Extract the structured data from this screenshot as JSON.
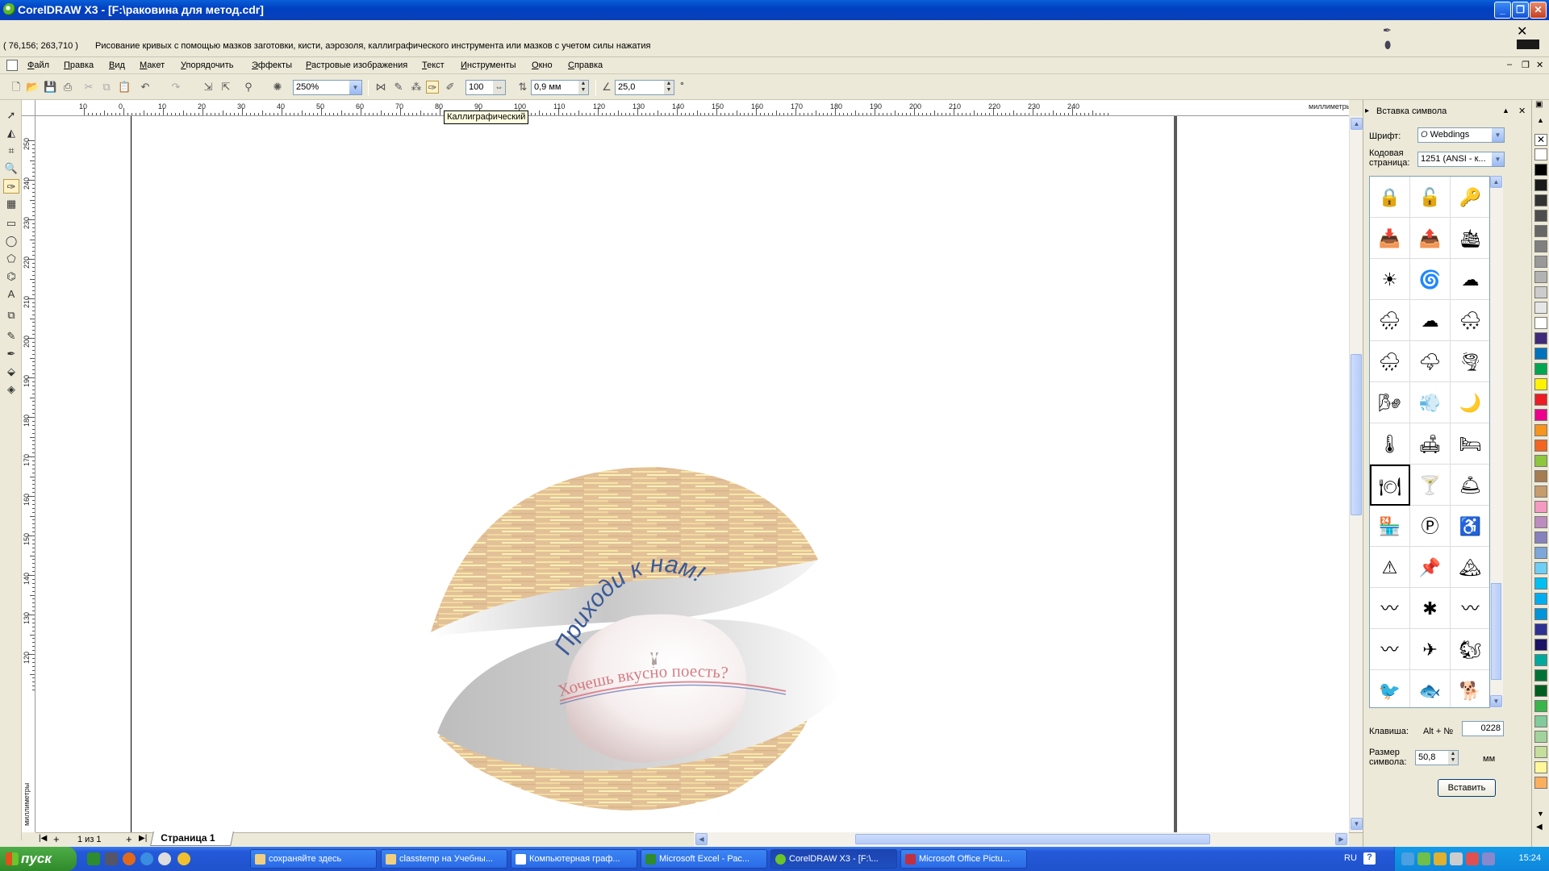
{
  "window": {
    "title": "CorelDRAW X3 - [F:\\раковина для метод.cdr]"
  },
  "hint": {
    "coords": "( 76,156; 263,710 )",
    "text": "Рисование кривых с помощью мазков заготовки, кисти, аэрозоля, каллиграфического инструмента или мазков с учетом силы нажатия"
  },
  "menu": [
    "Файл",
    "Правка",
    "Вид",
    "Макет",
    "Упорядочить",
    "Эффекты",
    "Растровые изображения",
    "Текст",
    "Инструменты",
    "Окно",
    "Справка"
  ],
  "propbar": {
    "zoom": "250%",
    "smoothing": "100",
    "width": "0,9 мм",
    "angle": "25,0",
    "angle_unit": "°"
  },
  "tooltip": "Каллиграфический",
  "ruler": {
    "unit": "миллиметры",
    "h_labels": [
      "10",
      "0",
      "10",
      "20",
      "30",
      "40",
      "50",
      "60",
      "70",
      "80",
      "90",
      "100",
      "110",
      "120",
      "130",
      "140",
      "150",
      "160",
      "170",
      "180",
      "190",
      "200",
      "210",
      "220",
      "230",
      "240"
    ],
    "v_labels": [
      "250",
      "240",
      "230",
      "220",
      "210",
      "200",
      "190",
      "180",
      "170",
      "160",
      "150",
      "140",
      "130",
      "120"
    ],
    "v_unit": "миллиметры"
  },
  "artwork": {
    "line1": "Приходи к нам!",
    "line2": "Хочешь вкусно поесть?"
  },
  "pagenav": {
    "counter": "1 из 1",
    "tab": "Страница 1"
  },
  "docker": {
    "title": "Вставка символа",
    "font_label": "Шрифт:",
    "font_value": "Webdings",
    "codepage_label": "Кодовая страница:",
    "codepage_value": "1251 (ANSI - к...",
    "key_label": "Клавиша:",
    "key_prefix": "Alt + №",
    "key_value": "0228",
    "size_label": "Размер символа:",
    "size_value": "50,8",
    "size_unit": "мм",
    "insert_button": "Вставить",
    "glyphs": [
      "🔒",
      "🔓",
      "🔑",
      "📥",
      "📤",
      "🛳",
      "☀",
      "🌀",
      "☁",
      "🌧",
      "☁",
      "🌨",
      "🌧",
      "🌩",
      "🌪",
      "🌬",
      "💨",
      "🌙",
      "🌡",
      "🛋",
      "🛏",
      "🍽",
      "🍸",
      "🛎",
      "🏪",
      "Ⓟ",
      "♿",
      "⚠",
      "📌",
      "🏔",
      "〰",
      "✱",
      "〰",
      "〰",
      "✈",
      "🐿",
      "🐦",
      "🐟",
      "🐕"
    ]
  },
  "palette": [
    "#ffffff",
    "#000000",
    "#1a1a1a",
    "#333333",
    "#4d4d4d",
    "#666666",
    "#808080",
    "#999999",
    "#b3b3b3",
    "#cccccc",
    "#e6e6e6",
    "#ffffff",
    "#3f2a7a",
    "#0072bc",
    "#00a651",
    "#fff200",
    "#ed1c24",
    "#ec008c",
    "#f7941d",
    "#f26522",
    "#8dc63f",
    "#a67c52",
    "#c69c6d",
    "#f49ac1",
    "#bd8cbf",
    "#8781bd",
    "#7da7d8",
    "#6dcff6",
    "#00bff3",
    "#00aeef",
    "#0095da",
    "#2e3192",
    "#1b1464",
    "#00a99d",
    "#007236",
    "#005e20",
    "#39b54a",
    "#82ca9c",
    "#a3d39c",
    "#c4df9b",
    "#fff799",
    "#fbaf5d"
  ],
  "taskbar": {
    "start": "пуск",
    "tasks": [
      "сохраняйте здесь",
      "classtemp на Учебны...",
      "Компьютерная граф...",
      "Microsoft Excel - Рас...",
      "CorelDRAW X3 - [F:\\...",
      "Microsoft Office Pictu..."
    ],
    "lang": "RU",
    "clock": "15:24"
  }
}
